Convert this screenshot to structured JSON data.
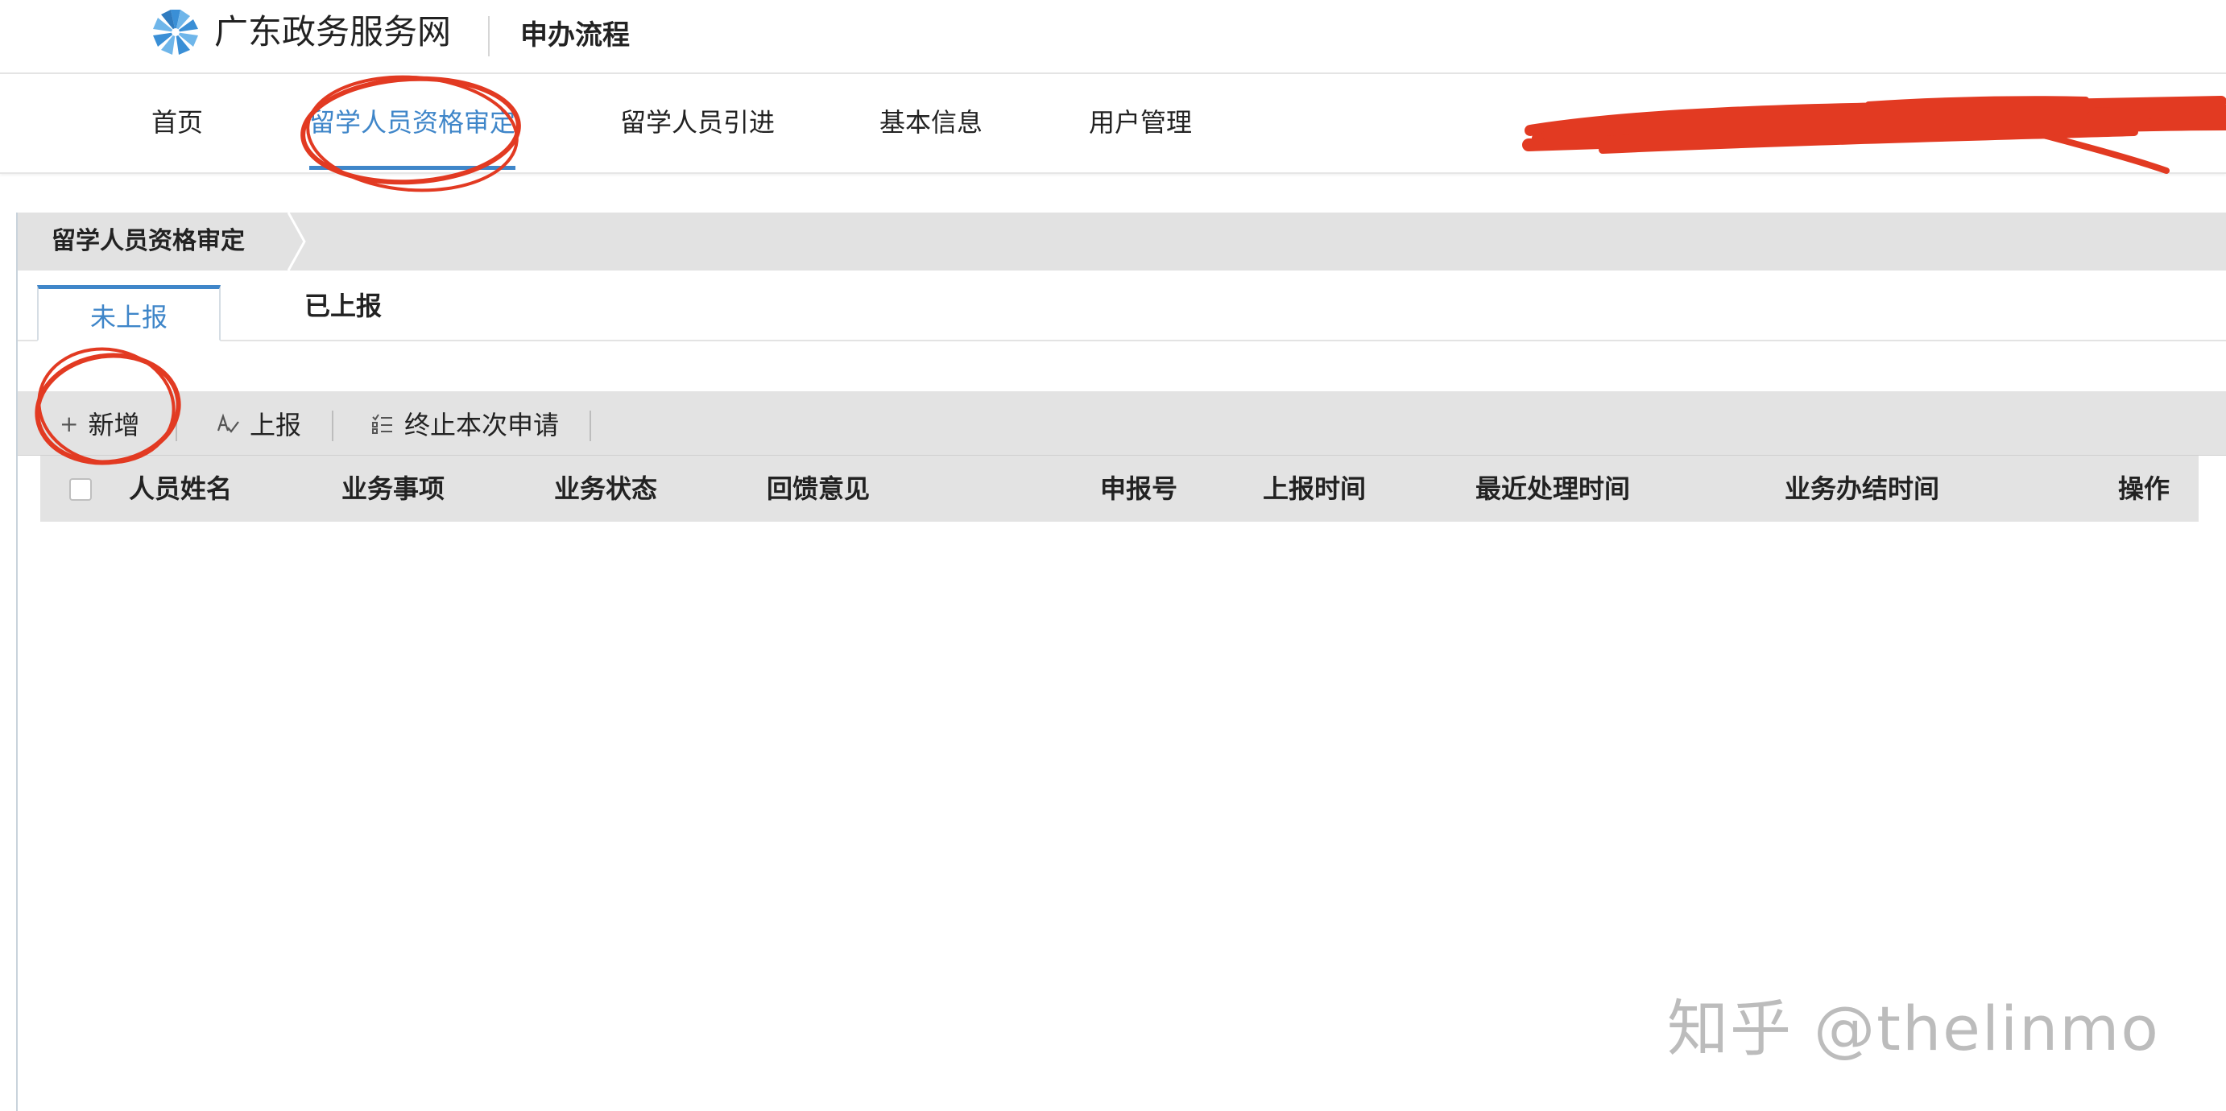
{
  "header": {
    "site_name": "广东政务服务网",
    "process_title": "申办流程"
  },
  "nav": {
    "items": [
      {
        "label": "首页"
      },
      {
        "label": "留学人员资格审定"
      },
      {
        "label": "留学人员引进"
      },
      {
        "label": "基本信息"
      },
      {
        "label": "用户管理"
      }
    ],
    "active_index": 1
  },
  "panel": {
    "title": "留学人员资格审定",
    "tabs": [
      {
        "label": "未上报"
      },
      {
        "label": "已上报"
      }
    ],
    "active_tab": 0
  },
  "toolbar": {
    "add_label": "新增",
    "report_label": "上报",
    "terminate_label": "终止本次申请"
  },
  "table": {
    "columns": [
      "人员姓名",
      "业务事项",
      "业务状态",
      "回馈意见",
      "申报号",
      "上报时间",
      "最近处理时间",
      "业务办结时间",
      "操作"
    ],
    "rows": []
  },
  "watermark": "知乎 @thelinmo",
  "colors": {
    "accent": "#3f86c9",
    "annotation_red": "#e23a22",
    "toolbar_bg": "#e3e3e3"
  },
  "icons": [
    "gov-logo-icon",
    "plus-icon",
    "report-icon",
    "terminate-list-icon",
    "checkbox-icon"
  ]
}
